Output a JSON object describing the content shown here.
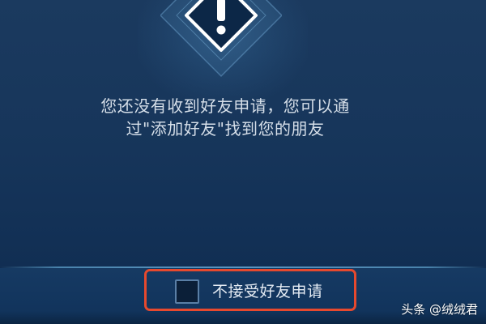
{
  "dialog": {
    "icon": "exclamation-icon",
    "message": "您还没有收到好友申请，您可以通过\"添加好友\"找到您的朋友",
    "checkbox": {
      "label": "不接受好友申请",
      "checked": false
    }
  },
  "watermark": {
    "text": "头条 @绒绒君"
  },
  "colors": {
    "background": "#17365b",
    "highlight": "#e7492e",
    "text": "#d6dfe9"
  }
}
